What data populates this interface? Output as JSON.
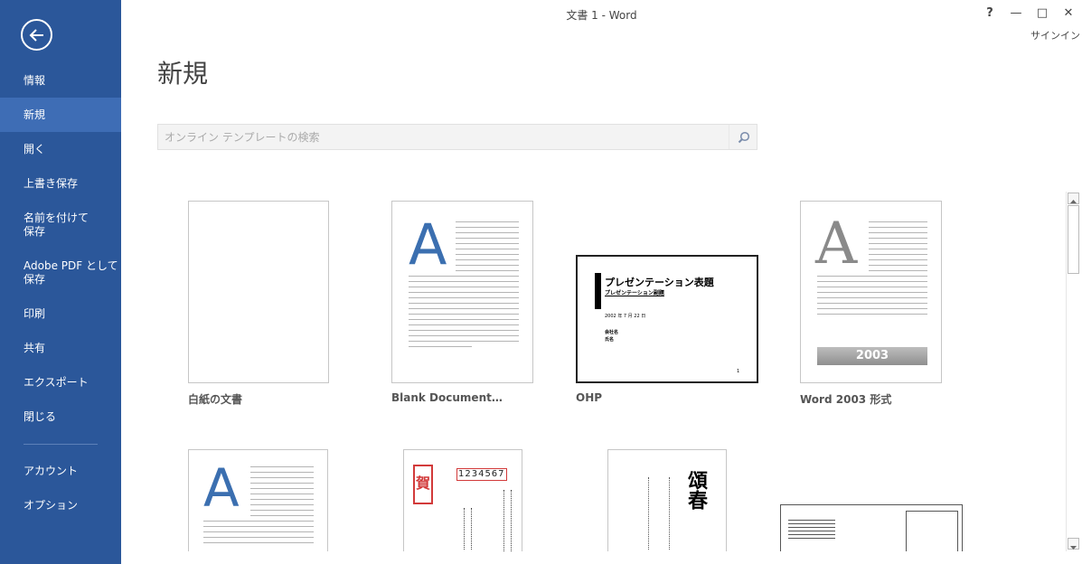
{
  "window": {
    "title": "文書 1 - Word",
    "help": "?",
    "minimize": "—",
    "maximize": "□",
    "close": "✕",
    "signin": "サインイン"
  },
  "sidebar": {
    "back_icon": "back-arrow-icon",
    "items": [
      {
        "label": "情報"
      },
      {
        "label": "新規",
        "active": true
      },
      {
        "label": "開く"
      },
      {
        "label": "上書き保存"
      },
      {
        "label": "名前を付けて\n保存"
      },
      {
        "label": "Adobe PDF として\n保存"
      },
      {
        "label": "印刷"
      },
      {
        "label": "共有"
      },
      {
        "label": "エクスポート"
      },
      {
        "label": "閉じる"
      },
      {
        "label": "アカウント"
      },
      {
        "label": "オプション"
      }
    ],
    "colors": {
      "background": "#2b579a",
      "active": "#3e6db5"
    }
  },
  "main": {
    "title": "新規",
    "search": {
      "placeholder": "オンライン テンプレートの検索",
      "icon": "search-icon"
    },
    "templates": [
      {
        "label": "白紙の文書"
      },
      {
        "label": "Blank Document…",
        "letter": "A"
      },
      {
        "label": "OHP",
        "thumb_title": "プレゼンテーション表題",
        "thumb_subtitle": "プレゼンテーション副題",
        "thumb_date": "2002 年 7 月 22 日",
        "thumb_name1": "会社名",
        "thumb_name2": "氏名",
        "thumb_page": "1"
      },
      {
        "label": "Word 2003 形式",
        "letter": "A",
        "badge": "2003"
      },
      {
        "label": "",
        "letter": "A"
      },
      {
        "label": "",
        "digits": "1234567"
      },
      {
        "label": "",
        "art": "頌春"
      },
      {
        "label": ""
      }
    ]
  }
}
